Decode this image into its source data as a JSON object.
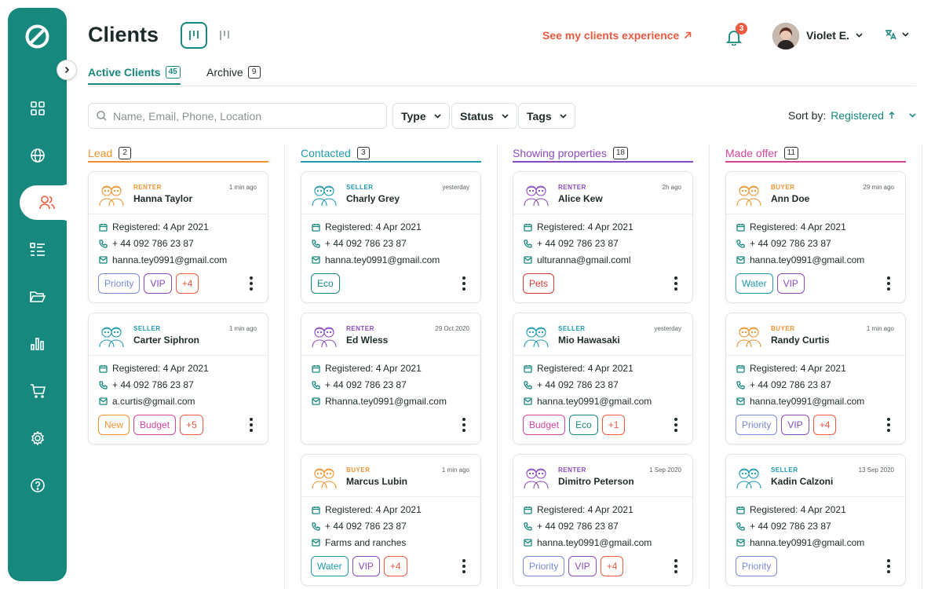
{
  "app": {
    "title": "Clients"
  },
  "colors": {
    "brand": "#16887e",
    "accent": "#ef5a3f",
    "lead": "#f0922e",
    "contacted": "#1e9ab0",
    "showing": "#8a4bbf",
    "offer": "#d4459b"
  },
  "header": {
    "experience_link": "See my clients experience",
    "notifications_count": "3",
    "user_name": "Violet E.",
    "lang_icon": "translate-icon"
  },
  "tabs": [
    {
      "label": "Active Clients",
      "count": "45"
    },
    {
      "label": "Archive",
      "count": "9"
    }
  ],
  "filters": {
    "search_placeholder": "Name, Email, Phone, Location",
    "type_label": "Type",
    "status_label": "Status",
    "tags_label": "Tags",
    "sort_label": "Sort by:",
    "sort_value": "Registered"
  },
  "columns": [
    {
      "title": "Lead",
      "count": "2",
      "cards": [
        {
          "role": "RENTER",
          "name": "Hanna Taylor",
          "time": "1 min ago",
          "registered": "Registered: 4 Apr 2021",
          "phone": "+ 44 092 786 23 87",
          "third": "hanna.tey0991@gmail.com",
          "third_icon": "mail-icon",
          "tags": [
            {
              "t": "Priority",
              "c": "#7b89d9"
            },
            {
              "t": "VIP",
              "c": "#8a4bbf"
            },
            {
              "t": "+4",
              "c": "#ef5a3f"
            }
          ]
        },
        {
          "role": "SELLER",
          "name": "Carter Siphron",
          "time": "1 min ago",
          "registered": "Registered: 4 Apr 2021",
          "phone": "+ 44 092 786 23 87",
          "third": "a.curtis@gmail.com",
          "third_icon": "mail-icon",
          "tags": [
            {
              "t": "New",
              "c": "#f0922e"
            },
            {
              "t": "Budget",
              "c": "#d4459b"
            },
            {
              "t": "+5",
              "c": "#ef5a3f"
            }
          ]
        }
      ]
    },
    {
      "title": "Contacted",
      "count": "3",
      "cards": [
        {
          "role": "SELLER",
          "name": "Charly Grey",
          "time": "yesterday",
          "registered": "Registered: 4 Apr 2021",
          "phone": "+ 44 092 786 23 87",
          "third": "hanna.tey0991@gmail.com",
          "third_icon": "mail-icon",
          "tags": [
            {
              "t": "Eco",
              "c": "#16887e"
            }
          ]
        },
        {
          "role": "RENTER",
          "name": "Ed Wless",
          "time": "29 Oct 2020",
          "registered": "Registered: 4 Apr 2021",
          "phone": "+ 44 092 786 23 87",
          "third": "Rhanna.tey0991@gmail.com",
          "third_icon": "mail-icon",
          "tags": []
        },
        {
          "role": "BUYER",
          "name": "Marcus Lubin",
          "time": "1 min ago",
          "registered": "Registered: 4 Apr 2021",
          "phone": "+ 44 092 786 23 87",
          "third": "Farms and ranches",
          "third_icon": "home-icon",
          "tags": [
            {
              "t": "Water",
              "c": "#1e9ab0"
            },
            {
              "t": "VIP",
              "c": "#8a4bbf"
            },
            {
              "t": "+4",
              "c": "#ef5a3f"
            }
          ]
        }
      ]
    },
    {
      "title": "Showing properties",
      "count": "18",
      "cards": [
        {
          "role": "RENTER",
          "name": "Alice Kew",
          "time": "2h ago",
          "registered": "Registered: 4 Apr 2021",
          "phone": "+ 44 092 786 23 87",
          "third": "ulturanna@gmail.coml",
          "third_icon": "mail-icon",
          "tags": [
            {
              "t": "Pets",
              "c": "#d93a3a"
            }
          ]
        },
        {
          "role": "SELLER",
          "name": "Mio Hawasaki",
          "time": "yesterday",
          "registered": "Registered: 4 Apr 2021",
          "phone": "+ 44 092 786 23 87",
          "third": "hanna.tey0991@gmail.com",
          "third_icon": "mail-icon",
          "tags": [
            {
              "t": "Budget",
              "c": "#d4459b"
            },
            {
              "t": "Eco",
              "c": "#16887e"
            },
            {
              "t": "+1",
              "c": "#ef5a3f"
            }
          ]
        },
        {
          "role": "RENTER",
          "name": "Dimitro Peterson",
          "time": "1 Sep 2020",
          "registered": "Registered: 4 Apr 2021",
          "phone": "+ 44 092 786 23 87",
          "third": "hanna.tey0991@gmail.com",
          "third_icon": "mail-icon",
          "tags": [
            {
              "t": "Priority",
              "c": "#7b89d9"
            },
            {
              "t": "VIP",
              "c": "#8a4bbf"
            },
            {
              "t": "+4",
              "c": "#ef5a3f"
            }
          ]
        }
      ]
    },
    {
      "title": "Made offer",
      "count": "11",
      "cards": [
        {
          "role": "BUYER",
          "name": "Ann Doe",
          "time": "29 min ago",
          "registered": "Registered: 4 Apr 2021",
          "phone": "+ 44 092 786 23 87",
          "third": "hanna.tey0991@gmail.com",
          "third_icon": "mail-icon",
          "tags": [
            {
              "t": "Water",
              "c": "#1e9ab0"
            },
            {
              "t": "VIP",
              "c": "#8a4bbf"
            }
          ]
        },
        {
          "role": "BUYER",
          "name": "Randy Curtis",
          "time": "1 min ago",
          "registered": "Registered: 4 Apr 2021",
          "phone": "+ 44 092 786 23 87",
          "third": "hanna.tey0991@gmail.com",
          "third_icon": "mail-icon",
          "tags": [
            {
              "t": "Priority",
              "c": "#7b89d9"
            },
            {
              "t": "VIP",
              "c": "#8a4bbf"
            },
            {
              "t": "+4",
              "c": "#ef5a3f"
            }
          ]
        },
        {
          "role": "SELLER",
          "name": "Kadin Calzoni",
          "time": "13 Sep 2020",
          "registered": "Registered: 4 Apr 2021",
          "phone": "+ 44 092 786 23 87",
          "third": "hanna.tey0991@gmail.com",
          "third_icon": "mail-icon",
          "tags": [
            {
              "t": "Priority",
              "c": "#7b89d9"
            }
          ]
        }
      ]
    }
  ],
  "sidebar": {
    "items": [
      "dashboard-icon",
      "globe-icon",
      "users-icon",
      "list-icon",
      "folder-icon",
      "chart-icon",
      "cart-icon",
      "settings-icon",
      "help-icon"
    ]
  }
}
